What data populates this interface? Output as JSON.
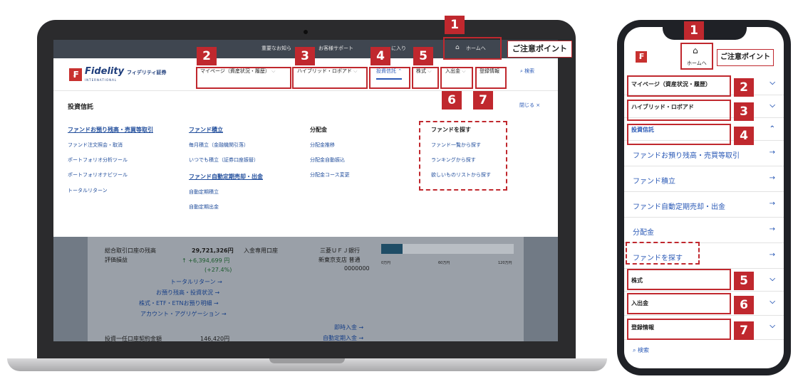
{
  "desktop": {
    "utility": {
      "important": "重要なお知ら",
      "support": "お客様サポート",
      "favorites": "に入り",
      "home": "ホームへ"
    },
    "logo": {
      "mark": "₣",
      "brand": "Fidelity",
      "brand_jp": "フィデリティ証券",
      "sub": "INTERNATIONAL"
    },
    "nav": [
      {
        "label": "マイページ（資産状況・履歴）"
      },
      {
        "label": "ハイブリッド・ロボアド"
      },
      {
        "label": "投資信託"
      },
      {
        "label": "株式"
      },
      {
        "label": "入出金"
      },
      {
        "label": "登録情報"
      }
    ],
    "search": "検索",
    "mega": {
      "title": "投資信託",
      "close": "閉じる ×",
      "col1": {
        "head": "ファンドお預り残高・売買等取引",
        "items": [
          "ファンド注文照会・取消",
          "ポートフォリオ分析ツール",
          "ポートフォリオナビツール",
          "トータルリターン"
        ]
      },
      "col2": {
        "head": "ファンド積立",
        "items": [
          "毎月積立（金融機関引落）",
          "いつでも積立（証券口座振替）"
        ],
        "head2": "ファンド自動定期売却・出金",
        "items2": [
          "自動定期積立",
          "自動定期出金"
        ]
      },
      "col3": {
        "head": "分配金",
        "items": [
          "分配金推移",
          "分配金自動振込",
          "分配金コース変更"
        ]
      },
      "col4": {
        "head": "ファンドを探す",
        "items": [
          "ファンド一覧から探す",
          "ランキングから探す",
          "欲しいものリストから探す"
        ]
      }
    },
    "bg": {
      "balance_label": "総合取引口座の残高",
      "pl_label": "評価損益",
      "balance": "29,721,326円",
      "pl": "↑ +6,394,699 円",
      "pl_pct": "(+27.4%)",
      "links": [
        "トータルリターン →",
        "お預り残高・投資状況 →",
        "株式・ETF・ETNお預り明細 →",
        "アカウント・アグリゲーション →"
      ],
      "dep_label": "入金専用口座",
      "bank": "三菱ＵＦＪ銀行",
      "branch": "新東京支店 普通",
      "acct": "0000000",
      "scale": [
        "0万円",
        "60万円",
        "120万円"
      ],
      "instant": "即時入金 →",
      "auto": "自動定期入金 →",
      "lump_label": "投資一任口座契約金額",
      "lump": "146,420円"
    }
  },
  "phone": {
    "home": "ホームへ",
    "rows": [
      "マイページ（資産状況・履歴）",
      "ハイブリッド・ロボアド",
      "投資信託"
    ],
    "subs": [
      "ファンドお預り残高・売買等取引",
      "ファンド積立",
      "ファンド自動定期売却・出金",
      "分配金",
      "ファンドを探す"
    ],
    "rows2": [
      "株式",
      "入出金",
      "登録情報"
    ],
    "search": "検索"
  },
  "annotations": {
    "callout": "ご注意ポイント",
    "numbers": [
      "1",
      "2",
      "3",
      "4",
      "5",
      "6",
      "7"
    ]
  },
  "colors": {
    "accent": "#c0282e",
    "link": "#2a59b6",
    "brand": "#c8312f"
  }
}
